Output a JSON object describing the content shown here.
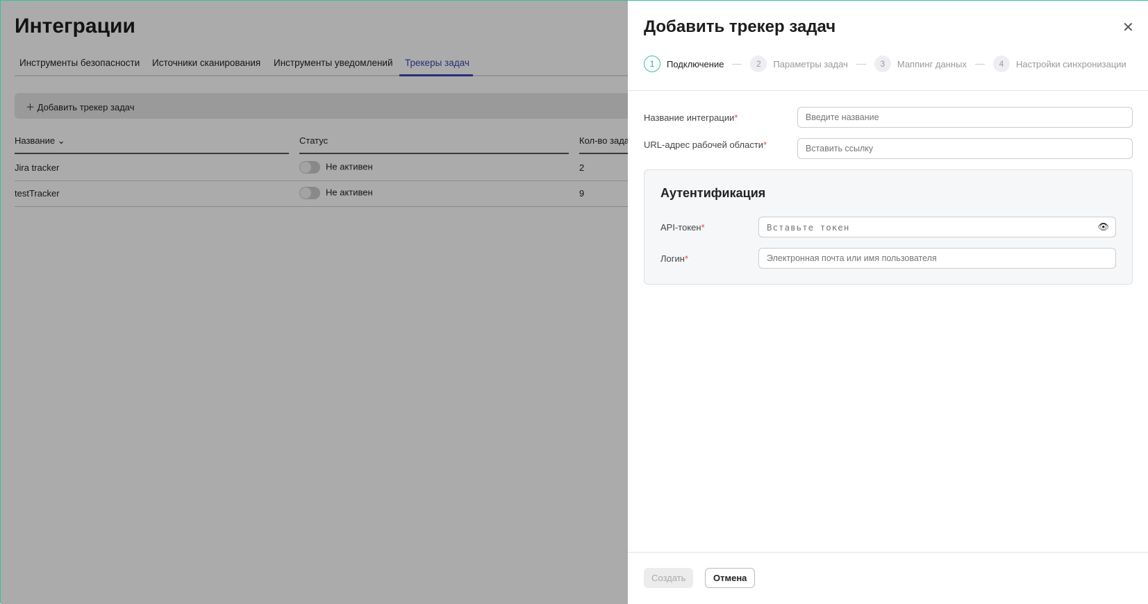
{
  "page": {
    "title": "Интеграции",
    "tabs": [
      {
        "label": "Инструменты безопасности"
      },
      {
        "label": "Источники сканирования"
      },
      {
        "label": "Инструменты уведомлений"
      },
      {
        "label": "Трекеры задач"
      }
    ],
    "add_button": "Добавить трекер задач",
    "table": {
      "headers": [
        "Название",
        "Статус",
        "Кол-во зада"
      ],
      "rows": [
        {
          "name": "Jira tracker",
          "status": "Не активен",
          "count": "2"
        },
        {
          "name": "testTracker",
          "status": "Не активен",
          "count": "9"
        }
      ]
    }
  },
  "panel": {
    "title": "Добавить трекер задач",
    "steps": [
      {
        "num": "1",
        "label": "Подключение"
      },
      {
        "num": "2",
        "label": "Параметры задач"
      },
      {
        "num": "3",
        "label": "Маппинг данных"
      },
      {
        "num": "4",
        "label": "Настройки синхронизации"
      }
    ],
    "fields": {
      "name_label": "Название интеграции",
      "name_placeholder": "Введите название",
      "url_label": "URL-адрес рабочей области",
      "url_placeholder": "Вставить ссылку"
    },
    "auth": {
      "title": "Аутентификация",
      "token_label": "API-токен",
      "token_placeholder": "Вставьте токен",
      "login_label": "Логин",
      "login_placeholder": "Электронная почта или имя пользователя"
    },
    "required_mark": "*",
    "create": "Создать",
    "cancel": "Отмена"
  },
  "colors": {
    "accent": "#3d44b5",
    "step_active": "#2ec4a0",
    "required": "#e44444"
  }
}
